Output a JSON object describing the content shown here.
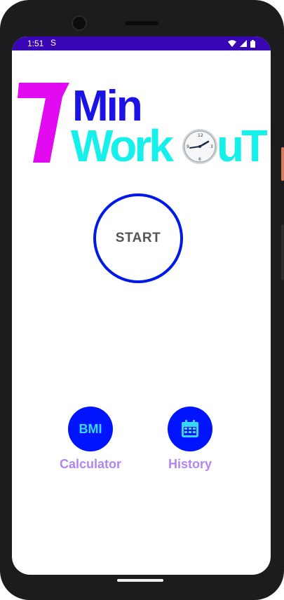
{
  "status_bar": {
    "time": "1:51",
    "notification_glyph": "S",
    "icons": [
      "wifi-icon",
      "signal-icon",
      "battery-icon"
    ]
  },
  "logo": {
    "number": "7",
    "word_top": "Min",
    "word_bottom_left": "Work",
    "word_bottom_right": "uT",
    "colors": {
      "number": "#e20af0",
      "top": "#1a12e6",
      "bottom": "#16f0ea"
    }
  },
  "start_button": {
    "label": "START",
    "border_color": "#0019e6"
  },
  "actions": {
    "bmi": {
      "icon_text": "BMI",
      "label": "Calculator"
    },
    "history": {
      "icon": "calendar-icon",
      "label": "History"
    }
  },
  "colors": {
    "status_bar": "#3a05b4",
    "accent_blue": "#0014ff",
    "label_purple": "#b286f0"
  }
}
